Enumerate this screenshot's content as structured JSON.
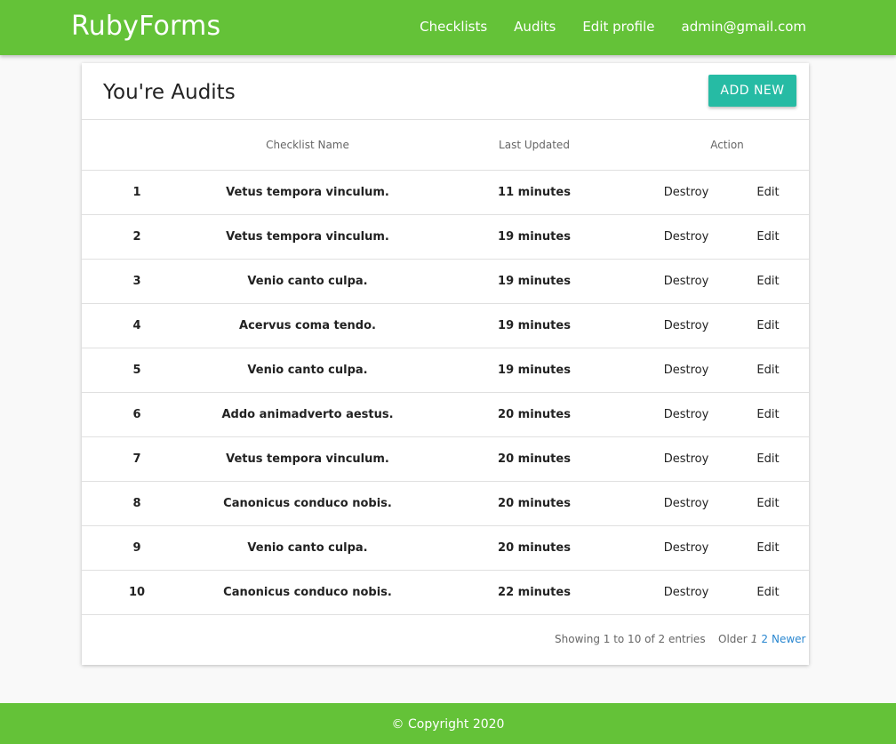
{
  "navbar": {
    "brand": "RubyForms",
    "links": [
      "Checklists",
      "Audits",
      "Edit profile",
      "admin@gmail.com"
    ],
    "bg_color": "#64c238"
  },
  "card": {
    "title": "You're Audits",
    "add_button": "ADD NEW",
    "accent_color": "#26bba4"
  },
  "table": {
    "headers": [
      "",
      "Checklist Name",
      "Last Updated",
      "Action"
    ],
    "rows": [
      {
        "index": "1",
        "name": "Vetus tempora vinculum.",
        "updated": "11 minutes",
        "destroy": "Destroy",
        "edit": "Edit"
      },
      {
        "index": "2",
        "name": "Vetus tempora vinculum.",
        "updated": "19 minutes",
        "destroy": "Destroy",
        "edit": "Edit"
      },
      {
        "index": "3",
        "name": "Venio canto culpa.",
        "updated": "19 minutes",
        "destroy": "Destroy",
        "edit": "Edit"
      },
      {
        "index": "4",
        "name": "Acervus coma tendo.",
        "updated": "19 minutes",
        "destroy": "Destroy",
        "edit": "Edit"
      },
      {
        "index": "5",
        "name": "Venio canto culpa.",
        "updated": "19 minutes",
        "destroy": "Destroy",
        "edit": "Edit"
      },
      {
        "index": "6",
        "name": "Addo animadverto aestus.",
        "updated": "20 minutes",
        "destroy": "Destroy",
        "edit": "Edit"
      },
      {
        "index": "7",
        "name": "Vetus tempora vinculum.",
        "updated": "20 minutes",
        "destroy": "Destroy",
        "edit": "Edit"
      },
      {
        "index": "8",
        "name": "Canonicus conduco nobis.",
        "updated": "20 minutes",
        "destroy": "Destroy",
        "edit": "Edit"
      },
      {
        "index": "9",
        "name": "Venio canto culpa.",
        "updated": "20 minutes",
        "destroy": "Destroy",
        "edit": "Edit"
      },
      {
        "index": "10",
        "name": "Canonicus conduco nobis.",
        "updated": "22 minutes",
        "destroy": "Destroy",
        "edit": "Edit"
      }
    ]
  },
  "pagination": {
    "info": "Showing 1 to 10 of 2 entries",
    "older": "Older",
    "current": "1",
    "next_page": "2",
    "newer": "Newer",
    "link_color": "#2a87d0"
  },
  "footer": {
    "copyright": "© Copyright 2020"
  }
}
